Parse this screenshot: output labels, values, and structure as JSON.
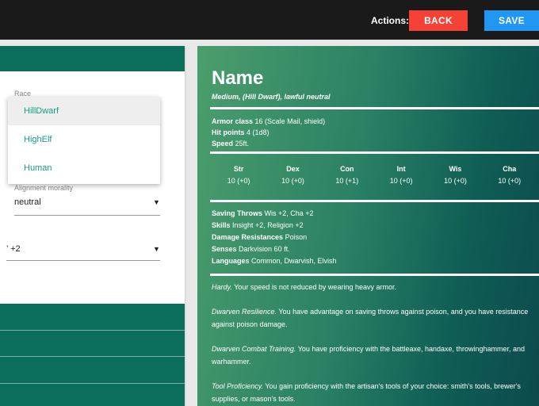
{
  "topbar": {
    "actions_label": "Actions:",
    "back_label": "BACK",
    "save_label": "SAVE"
  },
  "form": {
    "race_label": "Race",
    "race_options": [
      "HillDwarf",
      "HighElf",
      "Human"
    ],
    "race_selected": "HillDwarf",
    "alignment_label": "Alignment morality",
    "alignment_value": "neutral",
    "third_select_value": "’ +2"
  },
  "stat_block": {
    "name": "Name",
    "subtitle": "Medium, (Hill Dwarf), lawful neutral",
    "armor_class": {
      "label": "Armor class",
      "value": "16 (Scale Mail, shield)"
    },
    "hit_points": {
      "label": "Hit points",
      "value": "4 (1d8)"
    },
    "speed": {
      "label": "Speed",
      "value": "25ft."
    },
    "abilities": [
      {
        "name": "Str",
        "value": "10 (+0)"
      },
      {
        "name": "Dex",
        "value": "10 (+0)"
      },
      {
        "name": "Con",
        "value": "10 (+1)"
      },
      {
        "name": "Int",
        "value": "10 (+0)"
      },
      {
        "name": "Wis",
        "value": "10 (+0)"
      },
      {
        "name": "Cha",
        "value": "10 (+0)"
      }
    ],
    "saving_throws": {
      "label": "Saving Throws",
      "value": "Wis +2, Cha +2"
    },
    "skills": {
      "label": "Skills",
      "value": "Insight +2, Religion +2"
    },
    "damage_resistances": {
      "label": "Damage Resistances",
      "value": "Poison"
    },
    "senses": {
      "label": "Senses",
      "value": "Darkvision 60 ft."
    },
    "languages": {
      "label": "Languages",
      "value": "Common, Dwarvish, Elvish"
    },
    "traits": [
      {
        "name": "Hardy.",
        "text": "Your speed is not reduced by wearing heavy armor."
      },
      {
        "name": "Dwarven Resilience.",
        "text": "You have advantage on saving throws against poison, and you have resistance against poison damage."
      },
      {
        "name": "Dwarven Combat Training.",
        "text": "You have proficiency with the battleaxe, handaxe, throwinghammer, and warhammer."
      },
      {
        "name": "Tool Proficiency.",
        "text": "You gain proficiency with the artisan's tools of your choice: smith's tools, brewer's supplies, or mason's tools."
      }
    ]
  },
  "colors": {
    "topbar": "#1a1a1a",
    "back_button": "#f44336",
    "save_button": "#2196f3",
    "accent_green": "#0b6e5b",
    "dropdown_text": "#14a086"
  }
}
